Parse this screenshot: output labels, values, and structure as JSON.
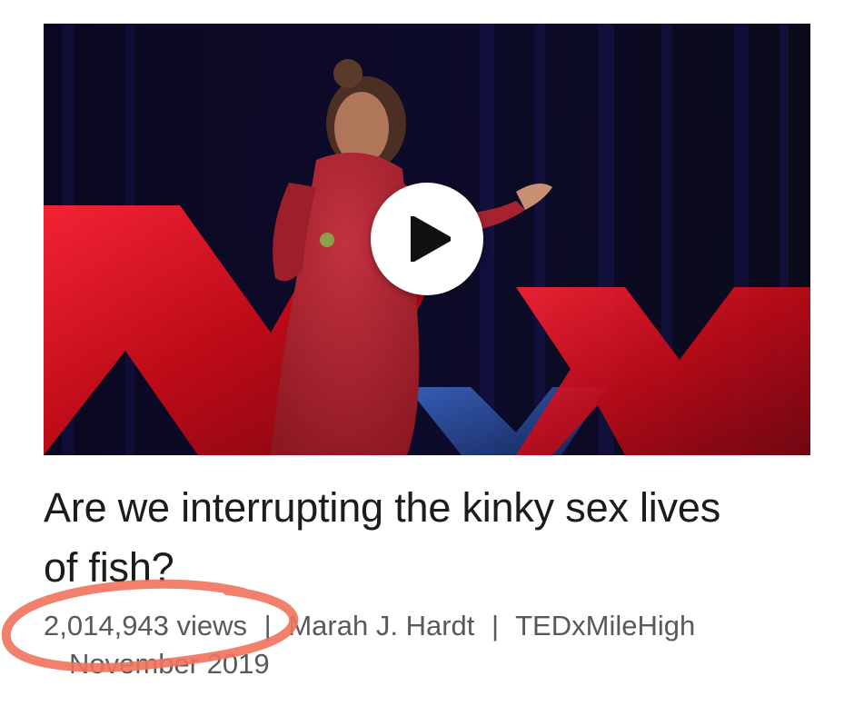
{
  "talk": {
    "title": "Are we interrupting the kinky sex lives of fish?",
    "views": "2,014,943 views",
    "separator": "|",
    "speaker": "Marah J. Hardt",
    "event": "TEDxMileHigh",
    "date": "November 2019"
  },
  "colors": {
    "annotation_stroke": "#f0735c",
    "stage_red": "#d8101c",
    "stage_blue": "#2a4fa0"
  },
  "icons": {
    "play": "play-icon"
  }
}
